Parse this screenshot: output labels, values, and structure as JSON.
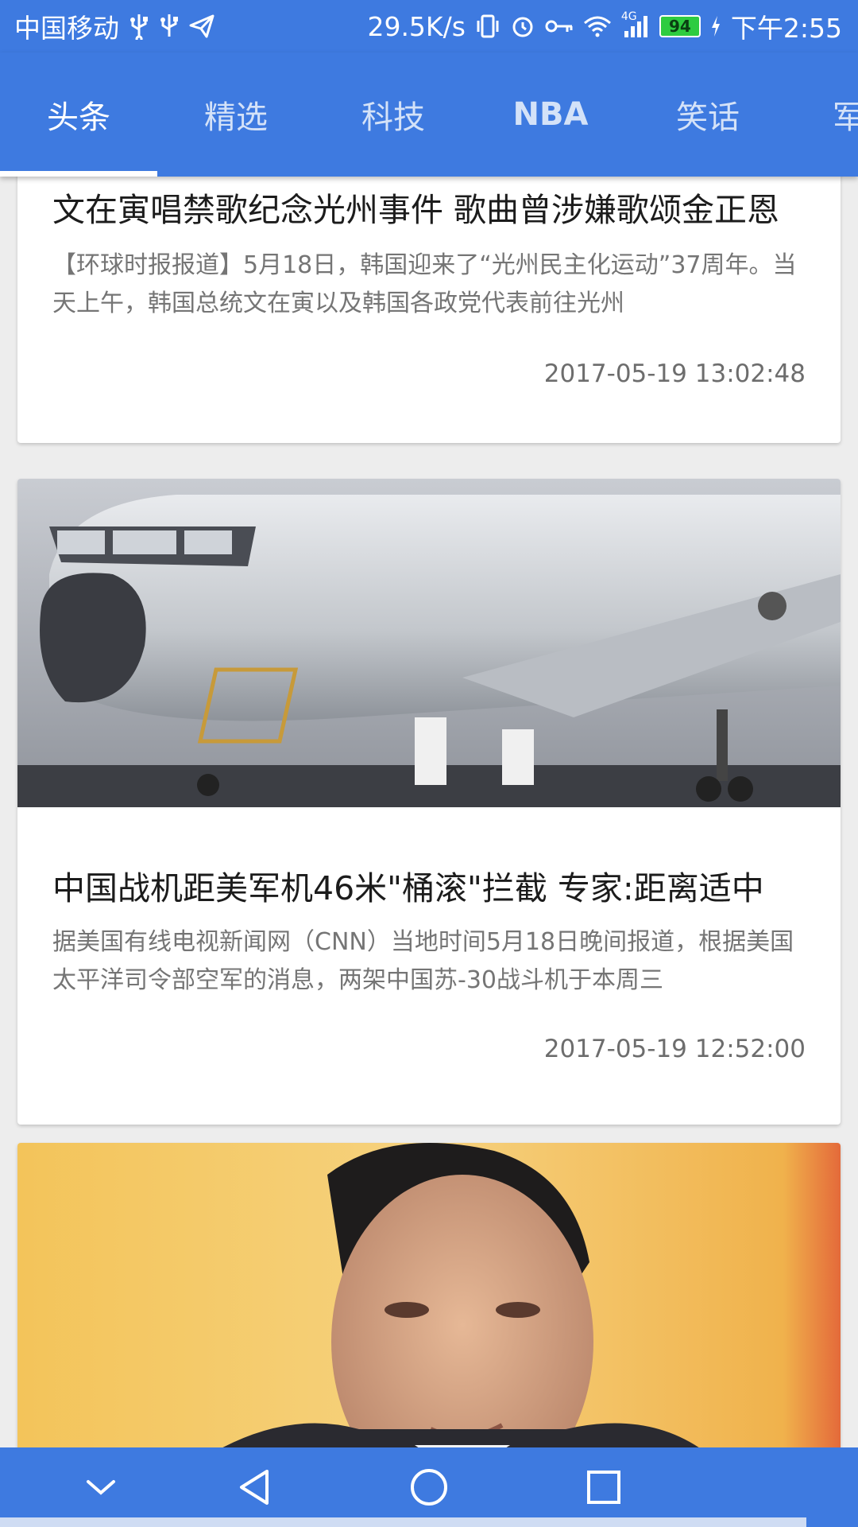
{
  "status_bar": {
    "carrier": "中国移动",
    "net_speed": "29.5K/s",
    "network_type": "4G",
    "battery": "94",
    "time": "下午2:55",
    "icons": [
      "usb-icon",
      "usb-icon",
      "send-icon",
      "vibrate-icon",
      "alarm-icon",
      "key-icon",
      "wifi-icon",
      "signal-icon",
      "battery-icon",
      "charging-icon"
    ]
  },
  "tabs": [
    {
      "label": "头条",
      "active": true
    },
    {
      "label": "精选",
      "active": false
    },
    {
      "label": "科技",
      "active": false
    },
    {
      "label": "NBA",
      "active": false
    },
    {
      "label": "笑话",
      "active": false
    },
    {
      "label": "军",
      "active": false
    }
  ],
  "articles": [
    {
      "title": "文在寅唱禁歌纪念光州事件 歌曲曾涉嫌歌颂金正恩",
      "summary": "【环球时报报道】5月18日，韩国迎来了“光州民主化运动”37周年。当天上午，韩国总统文在寅以及韩国各政党代表前往光州",
      "time": "2017-05-19 13:02:48"
    },
    {
      "image": "aircraft-photo",
      "title": "中国战机距美军机46米\"桶滚\"拦截 专家:距离适中",
      "summary": "据美国有线电视新闻网（CNN）当地时间5月18日晚间报道，根据美国太平洋司令部空军的消息，两架中国苏-30战斗机于本周三",
      "time": "2017-05-19 12:52:00"
    },
    {
      "image": "portrait-photo"
    }
  ],
  "nav_bar": {
    "buttons": [
      "chevron-down-icon",
      "back-icon",
      "home-icon",
      "recents-icon"
    ]
  },
  "colors": {
    "primary": "#3e7ae0",
    "background": "#ededed",
    "card": "#ffffff",
    "summary_text": "#757575"
  }
}
